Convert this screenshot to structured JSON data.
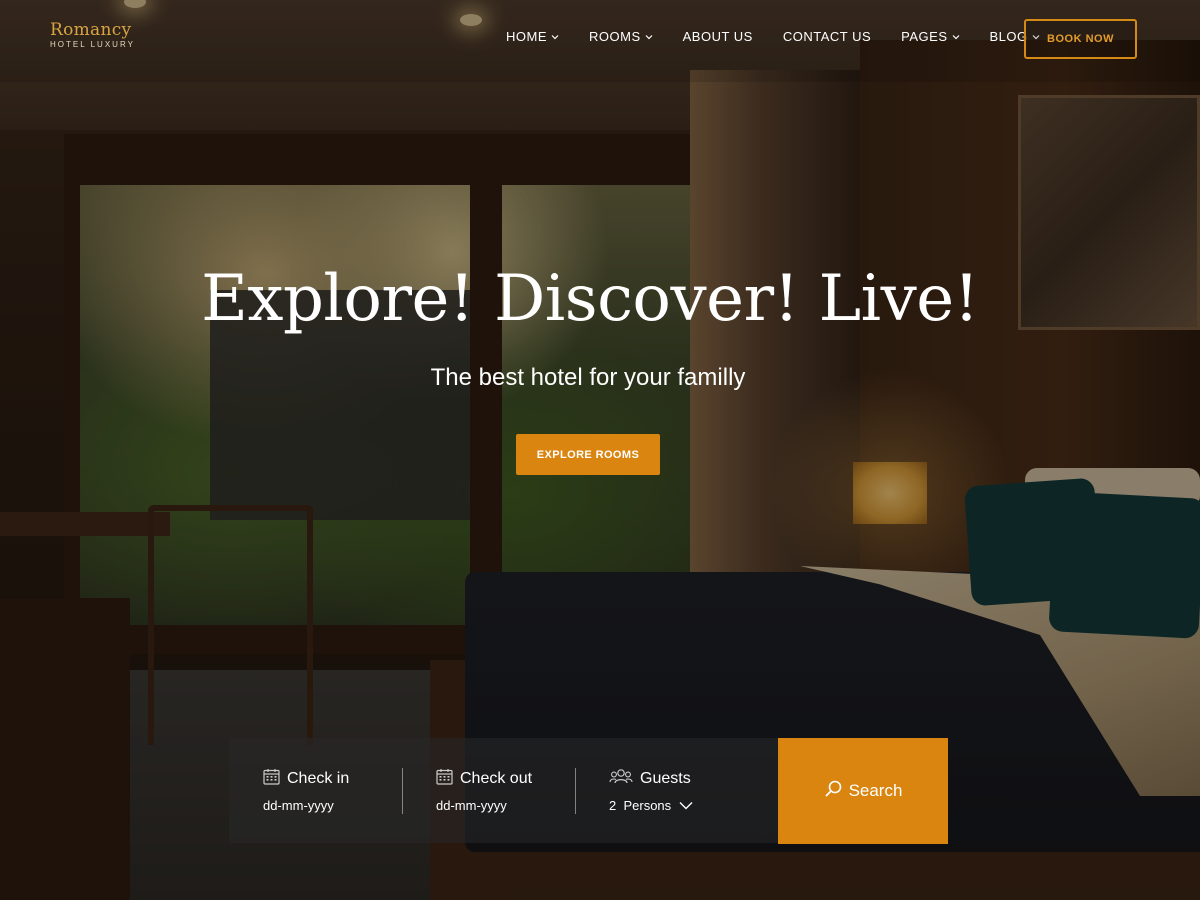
{
  "brand": {
    "name": "Romancy",
    "tagline": "HOTEL LUXURY"
  },
  "nav": {
    "items": [
      {
        "label": "HOME",
        "dropdown": true
      },
      {
        "label": "ROOMS",
        "dropdown": true
      },
      {
        "label": "ABOUT US",
        "dropdown": false
      },
      {
        "label": "CONTACT US",
        "dropdown": false
      },
      {
        "label": "PAGES",
        "dropdown": true
      },
      {
        "label": "BLOG",
        "dropdown": true
      }
    ],
    "cta": "BOOK NOW"
  },
  "hero": {
    "title": "Explore! Discover! Live!",
    "subtitle": "The best hotel for your familly",
    "button": "EXPLORE ROOMS"
  },
  "booking": {
    "checkin": {
      "label": "Check in",
      "value": "dd-mm-yyyy",
      "icon": "calendar-icon"
    },
    "checkout": {
      "label": "Check out",
      "value": "dd-mm-yyyy",
      "icon": "calendar-icon"
    },
    "guests": {
      "label": "Guests",
      "count": "2",
      "unit": "Persons",
      "icon": "users-icon"
    },
    "search_label": "Search"
  },
  "colors": {
    "accent": "#d9850f",
    "accent_outline": "#d58a16",
    "logo": "#d9a542"
  }
}
